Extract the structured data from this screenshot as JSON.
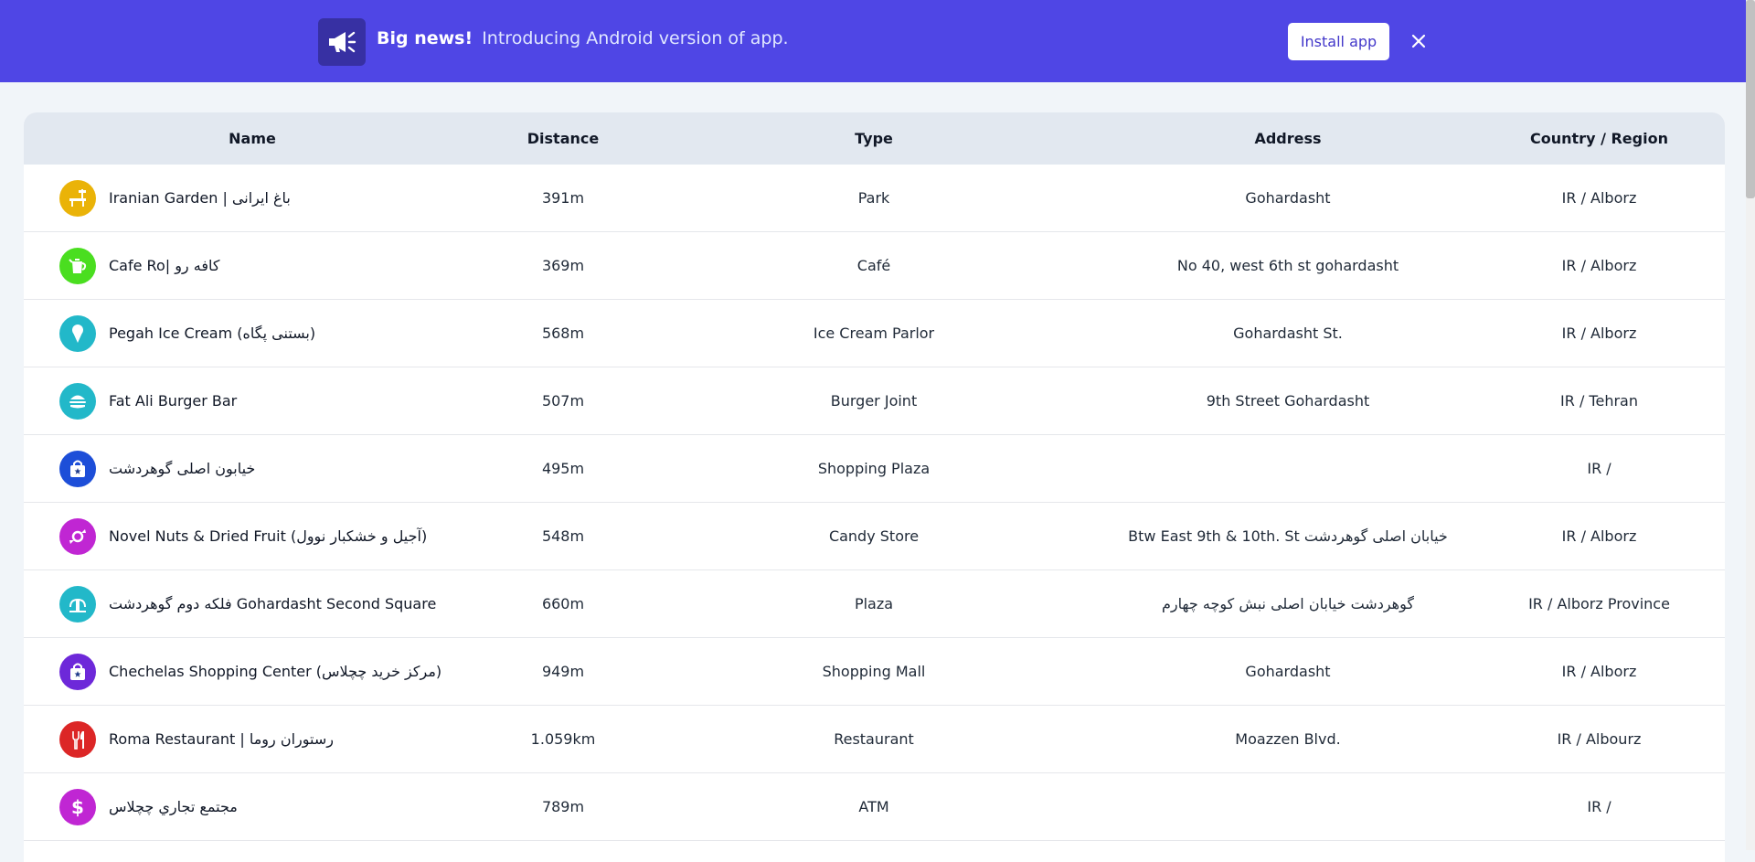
{
  "banner": {
    "headline": "Big news!",
    "message": "Introducing Android version of app.",
    "install_label": "Install app",
    "icon": "megaphone-icon",
    "background": "#4f46e5"
  },
  "table": {
    "columns": {
      "name": "Name",
      "distance": "Distance",
      "type": "Type",
      "address": "Address",
      "country": "Country / Region"
    },
    "rows": [
      {
        "name": "Iranian Garden | باغ ایرانی",
        "distance": "391m",
        "type": "Park",
        "address": "Gohardasht",
        "country": "IR / Alborz",
        "icon": "park-bench-icon",
        "color": "#eab308"
      },
      {
        "name": "Cafe Ro| کافه رو",
        "distance": "369m",
        "type": "Café",
        "address": "No 40, west 6th st gohardasht",
        "country": "IR / Alborz",
        "icon": "coffee-pot-icon",
        "color": "#4ade20"
      },
      {
        "name": "Pegah Ice Cream (بستنی پگاه)",
        "distance": "568m",
        "type": "Ice Cream Parlor",
        "address": "Gohardasht St.",
        "country": "IR / Alborz",
        "icon": "ice-cream-icon",
        "color": "#22b8c9"
      },
      {
        "name": "Fat Ali Burger Bar",
        "distance": "507m",
        "type": "Burger Joint",
        "address": "9th Street Gohardasht",
        "country": "IR / Tehran",
        "icon": "burger-icon",
        "color": "#22b8c9"
      },
      {
        "name": "خیابون اصلی گوهردشت",
        "distance": "495m",
        "type": "Shopping Plaza",
        "address": "",
        "country": "IR /",
        "icon": "shopping-bag-icon",
        "color": "#1d4ed8"
      },
      {
        "name": "Novel Nuts & Dried Fruit (آجیل و خشکبار نوول)",
        "distance": "548m",
        "type": "Candy Store",
        "address": "Btw East 9th & 10th. St خیابان اصلی گوهردشت",
        "country": "IR / Alborz",
        "icon": "candy-icon",
        "color": "#c026d3"
      },
      {
        "name": "فلکه دوم گوهردشت Gohardasht Second Square",
        "distance": "660m",
        "type": "Plaza",
        "address": "گوهردشت خیابان اصلی نبش کوچه چهارم",
        "country": "IR / Alborz Province",
        "icon": "fountain-icon",
        "color": "#22b8c9"
      },
      {
        "name": "Chechelas Shopping Center (مرکز خرید چچلاس)",
        "distance": "949m",
        "type": "Shopping Mall",
        "address": "Gohardasht",
        "country": "IR / Alborz",
        "icon": "shopping-bag-icon",
        "color": "#6d28d9"
      },
      {
        "name": "Roma Restaurant | رستوران روما",
        "distance": "1.059km",
        "type": "Restaurant",
        "address": "Moazzen Blvd.",
        "country": "IR / Albourz",
        "icon": "fork-knife-icon",
        "color": "#dc2626"
      },
      {
        "name": "مجتمع تجاري چچلاس",
        "distance": "789m",
        "type": "ATM",
        "address": "",
        "country": "IR /",
        "icon": "dollar-icon",
        "color": "#c026d3"
      }
    ]
  }
}
